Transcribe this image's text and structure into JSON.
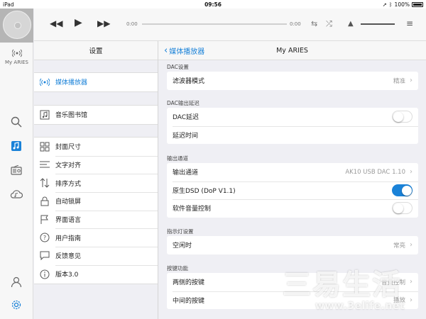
{
  "status_bar": {
    "device": "iPad",
    "time": "09:56",
    "battery": "100%"
  },
  "rail": {
    "device_name": "My ARIES",
    "items": [
      {
        "icon": "search-icon"
      },
      {
        "icon": "music-note-icon"
      },
      {
        "icon": "radio-icon"
      },
      {
        "icon": "cloud-music-icon"
      },
      {
        "icon": "profile-icon"
      },
      {
        "icon": "gear-icon"
      }
    ]
  },
  "player": {
    "elapsed": "0:00",
    "total": "0:00"
  },
  "settings_panel": {
    "title": "设置",
    "group1": [
      {
        "icon": "radio-wave-icon",
        "label": "媒体播放器",
        "active": true
      }
    ],
    "group2": [
      {
        "icon": "library-icon",
        "label": "音乐图书馆"
      }
    ],
    "group3": [
      {
        "icon": "grid-icon",
        "label": "封面尺寸"
      },
      {
        "icon": "text-align-icon",
        "label": "文字对齐"
      },
      {
        "icon": "sort-icon",
        "label": "排序方式"
      },
      {
        "icon": "lock-icon",
        "label": "自动锁屏"
      },
      {
        "icon": "flag-icon",
        "label": "界面语言"
      },
      {
        "icon": "help-icon",
        "label": "用户指南"
      },
      {
        "icon": "chat-icon",
        "label": "反馈意见"
      },
      {
        "icon": "info-icon",
        "label": "版本3.0"
      }
    ]
  },
  "detail": {
    "back_label": "媒体播放器",
    "title": "My ARIES",
    "sections": {
      "dac": {
        "label": "DAC设置",
        "rows": [
          {
            "label": "滤波器模式",
            "value": "精准"
          }
        ]
      },
      "delay": {
        "label": "DAC输出延迟",
        "rows": [
          {
            "label": "DAC延迟",
            "toggle": false
          },
          {
            "label": "延迟时间"
          }
        ]
      },
      "output": {
        "label": "输出通道",
        "rows": [
          {
            "label": "输出通道",
            "value": "AK10 USB DAC 1.10"
          },
          {
            "label": "原生DSD (DoP V1.1)",
            "toggle": true
          },
          {
            "label": "软件音量控制",
            "toggle": false
          }
        ]
      },
      "indicator": {
        "label": "指示灯设置",
        "rows": [
          {
            "label": "空闲时",
            "value": "常亮"
          }
        ]
      },
      "buttons": {
        "label": "按键功能",
        "rows": [
          {
            "label": "两侧的按键",
            "value": "音量控制"
          },
          {
            "label": "中间的按键",
            "value": "播放"
          }
        ]
      }
    }
  },
  "watermark": {
    "big": "三易生活",
    "small": "www.3elife.net"
  },
  "colors": {
    "accent": "#1a82d8",
    "background": "#efeff4"
  }
}
